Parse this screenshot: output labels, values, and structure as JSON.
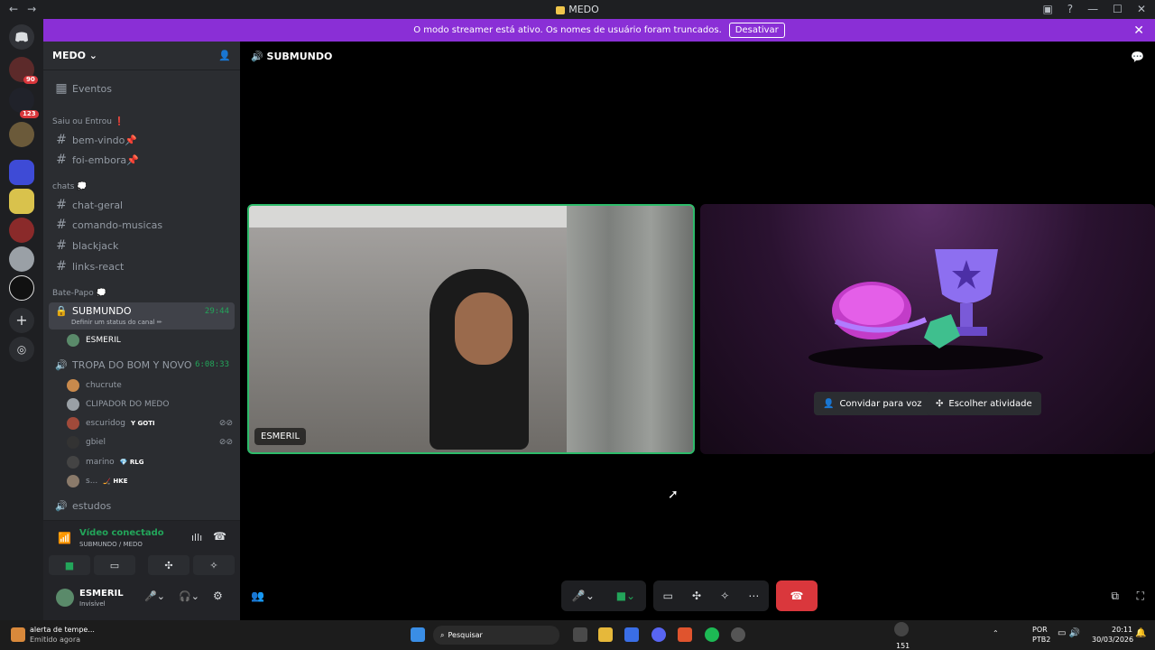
{
  "window": {
    "title": "MEDO"
  },
  "banner": {
    "text": "O modo streamer está ativo. Os nomes de usuário foram truncados.",
    "button": "Desativar"
  },
  "guild_badges": [
    "90",
    "123"
  ],
  "server": {
    "name": "MEDO"
  },
  "channels": {
    "events": "Eventos",
    "cat1": "Saiu ou Entrou ❗",
    "ch1": "bem-vindo📌",
    "ch2": "foi-embora📌",
    "cat2": "chats 💭",
    "ch3": "chat-geral",
    "ch4": "comando-musicas",
    "ch5": "blackjack",
    "ch6": "links-react",
    "cat3": "Bate-Papo 💭",
    "voice1": "SUBMUNDO",
    "voice1_timer": "29:44",
    "voice1_status": "Definir um status do canal ✏",
    "voice1_user": "ESMERIL",
    "voice2": "TROPA DO BOM Y NOVO",
    "voice2_timer": "6:08:33",
    "voice2_users": [
      {
        "name": "chucrute",
        "tag": ""
      },
      {
        "name": "CLIPADOR DO MEDO",
        "tag": ""
      },
      {
        "name": "escuridog",
        "tag": "Y GOTI"
      },
      {
        "name": "gbiel",
        "tag": ""
      },
      {
        "name": "marino",
        "tag": "💎 RLG"
      },
      {
        "name": "s...",
        "tag": "🏒 HKE"
      }
    ],
    "voice3": "estudos"
  },
  "voice_panel": {
    "status": "Vídeo conectado",
    "location": "SUBMUNDO / MEDO"
  },
  "user_panel": {
    "name": "ESMERIL",
    "status": "Invisível"
  },
  "main": {
    "channel": "SUBMUNDO",
    "video_user": "ESMERIL",
    "invite_btn": "Convidar para voz",
    "activity_btn": "Escolher atividade"
  },
  "taskbar": {
    "notif_title": "alerta de tempe...",
    "notif_sub": "Emitido agora",
    "search": "Pesquisar",
    "lang": "POR",
    "lang2": "PTB2",
    "time": "20:11",
    "date": "30/03/2026",
    "chat_count": "151"
  }
}
